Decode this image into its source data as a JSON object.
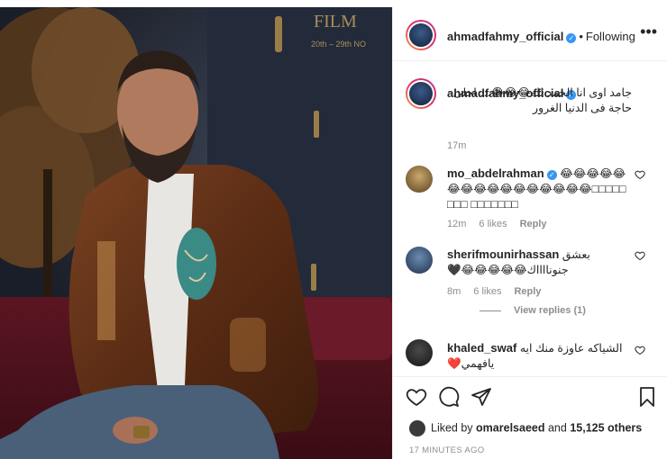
{
  "post": {
    "author": "ahmadfahmy_official",
    "separator": "•",
    "follow_state": "Following",
    "more_label": "•••"
  },
  "photo": {
    "backdrop_text": "FILM",
    "backdrop_dates": "20th – 29th NO"
  },
  "caption": {
    "username": "ahmadfahmy_official",
    "text": "جامد اوى انا الحمد لله😂😂😂… احلى حاجة فى الدنيا الغرور",
    "time": "17m"
  },
  "comments": [
    {
      "username": "mo_abdelrahman",
      "verified": true,
      "text": "😂😂😂😂😂😂😂😂😂😂😂😂😂😂😂😂□□□□□□□□ □□□□□□□",
      "time": "12m",
      "likes": "6 likes",
      "reply": "Reply"
    },
    {
      "username": "sherifmounirhassan",
      "verified": false,
      "text": "بعشق جنونااااك😂😂😂😂😂🖤",
      "time": "8m",
      "likes": "6 likes",
      "reply": "Reply",
      "view_replies": "View replies (1)"
    },
    {
      "username": "khaled_swaf",
      "verified": false,
      "text": "الشياكه عاوزة منك ايه يافهمي❤️",
      "time": "",
      "likes": "",
      "reply": ""
    }
  ],
  "footer": {
    "liked_by_prefix": "Liked by",
    "liked_by_user": "omarelsaeed",
    "liked_by_and": "and",
    "liked_by_count": "15,125 others",
    "timestamp": "17 MINUTES AGO"
  },
  "icons": {
    "like": "heart-icon",
    "comment": "comment-icon",
    "share": "paper-plane-icon",
    "save": "bookmark-icon",
    "verified": "verified-badge-icon"
  },
  "colors": {
    "text": "#262626",
    "muted": "#8e8e8e",
    "verified": "#3897f0",
    "border": "#efefef",
    "jacket": "#6b3a1f"
  }
}
